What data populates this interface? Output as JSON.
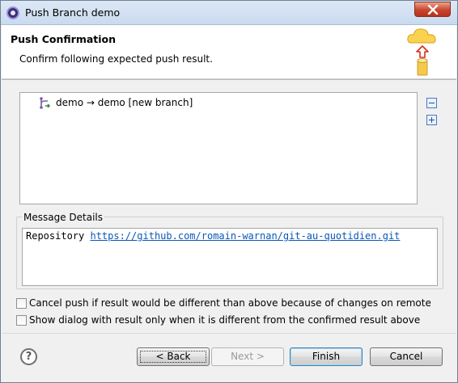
{
  "window": {
    "title": "Push Branch demo",
    "icon": "eclipse-icon"
  },
  "banner": {
    "title": "Push Confirmation",
    "message": "Confirm following expected push result.",
    "icon": "push-to-cloud-icon"
  },
  "tree": {
    "items": [
      {
        "icon": "branch-push-icon",
        "label": "demo → demo [new branch]"
      }
    ],
    "collapse_icon": "collapse-all-icon",
    "expand_icon": "expand-all-icon"
  },
  "details": {
    "legend": "Message Details",
    "repository_label": "Repository",
    "repository_url": "https://github.com/romain-warnan/git-au-quotidien.git"
  },
  "options": {
    "cancel_if_different": {
      "label": "Cancel push if result would be different than above because of changes on remote",
      "checked": false
    },
    "show_dialog_only_if_different": {
      "label": "Show dialog with result only when it is different from the confirmed result above",
      "checked": false
    }
  },
  "buttons": {
    "back": "< Back",
    "next": "Next >",
    "finish": "Finish",
    "cancel": "Cancel",
    "help": "?"
  }
}
